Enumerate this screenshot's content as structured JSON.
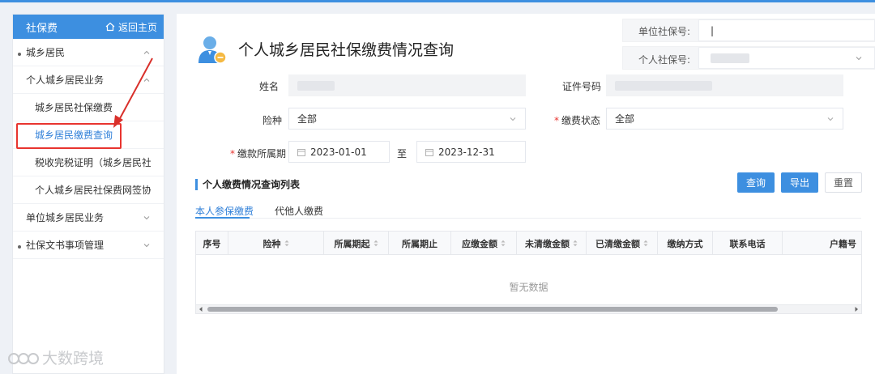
{
  "sidebar": {
    "header_title": "社保费",
    "home_label": "返回主页",
    "items": [
      {
        "label": "城乡居民"
      },
      {
        "label": "个人城乡居民业务"
      },
      {
        "label": "城乡居民社保缴费"
      },
      {
        "label": "城乡居民缴费查询"
      },
      {
        "label": "税收完税证明（城乡居民社保文书）"
      },
      {
        "label": "个人城乡居民社保费网签协议"
      },
      {
        "label": "单位城乡居民业务"
      },
      {
        "label": "社保文书事项管理"
      }
    ]
  },
  "header": {
    "title": "个人城乡居民社保缴费情况查询",
    "unit_ss_label": "单位社保号:",
    "unit_ss_value": "|",
    "personal_ss_label": "个人社保号:"
  },
  "form": {
    "name_label": "姓名",
    "id_label": "证件号码",
    "insurance_label": "险种",
    "insurance_value": "全部",
    "status_label": "缴费状态",
    "status_value": "全部",
    "period_label": "缴款所属期",
    "period_start": "2023-01-01",
    "period_sep": "至",
    "period_end": "2023-12-31",
    "required_mark": "*"
  },
  "section": {
    "title": "个人缴费情况查询列表",
    "query_btn": "查询",
    "export_btn": "导出",
    "reset_btn": "重置"
  },
  "tabs": [
    {
      "label": "本人参保缴费"
    },
    {
      "label": "代他人缴费"
    }
  ],
  "table": {
    "columns": [
      "序号",
      "险种",
      "所属期起",
      "所属期止",
      "应缴金额",
      "未清缴金额",
      "已清缴金额",
      "缴纳方式",
      "联系电话",
      "户籍号"
    ],
    "empty_text": "暂无数据"
  },
  "watermark": {
    "text": "大数跨境"
  },
  "colors": {
    "accent": "#3d8fe0",
    "highlight": "#e8342f"
  }
}
